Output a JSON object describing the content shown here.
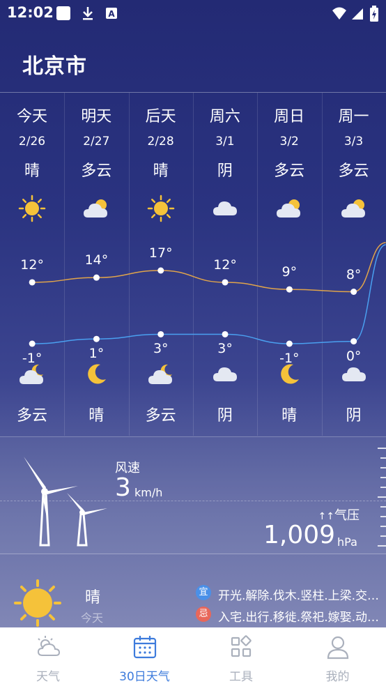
{
  "status_bar": {
    "time": "12:02",
    "icons": [
      "notification-square-icon",
      "download-icon",
      "keyboard-a-icon",
      "wifi-icon",
      "signal-icon",
      "battery-charging-icon"
    ]
  },
  "city": "北京市",
  "days": [
    {
      "day": "今天",
      "date": "2/26",
      "cond_day": "晴",
      "icon_day": "sun",
      "high": "12°",
      "low": "-1°",
      "icon_night": "cloud-moon",
      "cond_night": "多云"
    },
    {
      "day": "明天",
      "date": "2/27",
      "cond_day": "多云",
      "icon_day": "cloud-sun",
      "high": "14°",
      "low": "1°",
      "icon_night": "moon",
      "cond_night": "晴"
    },
    {
      "day": "后天",
      "date": "2/28",
      "cond_day": "晴",
      "icon_day": "sun",
      "high": "17°",
      "low": "3°",
      "icon_night": "cloud-moon",
      "cond_night": "多云"
    },
    {
      "day": "周六",
      "date": "3/1",
      "cond_day": "阴",
      "icon_day": "cloud",
      "high": "12°",
      "low": "3°",
      "icon_night": "cloud",
      "cond_night": "阴"
    },
    {
      "day": "周日",
      "date": "3/2",
      "cond_day": "多云",
      "icon_day": "cloud-sun",
      "high": "9°",
      "low": "-1°",
      "icon_night": "moon",
      "cond_night": "晴"
    },
    {
      "day": "周一",
      "date": "3/3",
      "cond_day": "多云",
      "icon_day": "cloud-sun",
      "high": "8°",
      "low": "0°",
      "icon_night": "cloud",
      "cond_night": "阴"
    }
  ],
  "chart_data": {
    "type": "line",
    "categories": [
      "2/26",
      "2/27",
      "2/28",
      "3/1",
      "3/2",
      "3/3"
    ],
    "series": [
      {
        "values": [
          12,
          14,
          17,
          12,
          9,
          8
        ],
        "color": "#e0a44a"
      },
      {
        "values": [
          -1,
          1,
          3,
          3,
          -1,
          0
        ],
        "color": "#4aa0f0"
      }
    ]
  },
  "wind": {
    "label": "风速",
    "value": "3",
    "unit": "km/h"
  },
  "pressure": {
    "label": "气压",
    "arrows": "↑↑",
    "value": "1,009",
    "unit": "hPa"
  },
  "today": {
    "condition": "晴",
    "sub": "今天",
    "yi_badge": "宜",
    "yi_text": "开光.解除.伐木.竖柱.上梁.交…",
    "ji_badge": "忌",
    "ji_text": "入宅.出行.移徙.祭祀.嫁娶.动…",
    "yi_color": "#4a90e8",
    "ji_color": "#e8675a"
  },
  "nav": [
    {
      "label": "天气",
      "icon": "weather-icon",
      "active": false
    },
    {
      "label": "30日天气",
      "icon": "calendar-icon",
      "active": true
    },
    {
      "label": "工具",
      "icon": "tools-grid-icon",
      "active": false
    },
    {
      "label": "我的",
      "icon": "profile-icon",
      "active": false
    }
  ]
}
